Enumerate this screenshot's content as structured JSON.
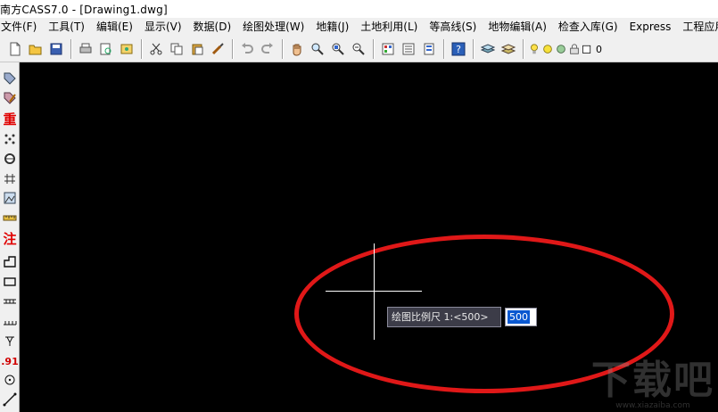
{
  "window": {
    "title": "南方CASS7.0 - [Drawing1.dwg]"
  },
  "menu": {
    "items": [
      "文件(F)",
      "工具(T)",
      "编辑(E)",
      "显示(V)",
      "数据(D)",
      "绘图处理(W)",
      "地籍(J)",
      "土地利用(L)",
      "等高线(S)",
      "地物编辑(A)",
      "检查入库(G)",
      "Express",
      "工程应用"
    ]
  },
  "toolbar": {
    "layer_value": "0"
  },
  "left_toolbar": {
    "char_zhong": "重",
    "char_zhu": "注",
    "num_label": ".91"
  },
  "canvas": {
    "prompt_label": "绘图比例尺 1:<500>",
    "input_value": "500"
  },
  "watermark": {
    "big": "下载吧",
    "small": "www.xiazaiba.com"
  },
  "colors": {
    "canvas_bg": "#000000",
    "highlight_circle": "#e01818",
    "selection": "#0a58d0"
  }
}
